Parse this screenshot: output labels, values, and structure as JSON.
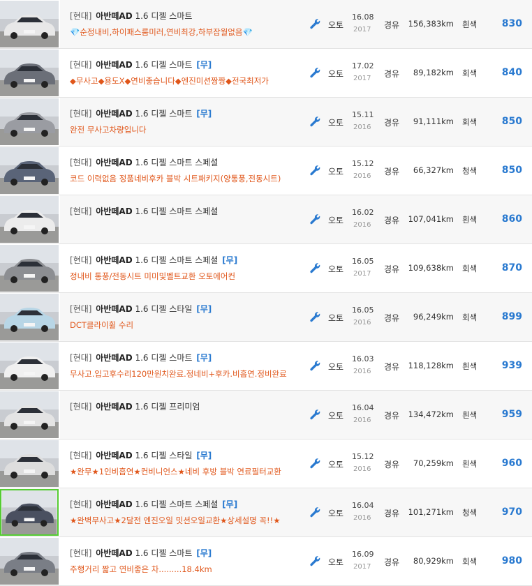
{
  "colors": {
    "accent_blue": "#2a7ad0",
    "desc_orange": "#e0561a",
    "selected_border": "#55cc33"
  },
  "listings": [
    {
      "maker": "[현대]",
      "model": "아반떼AD",
      "trim": "1.6 디젤 스마트",
      "badge": "",
      "desc": "💎순정내비,하이패스룸미러,연비최강,하부잡월없음💎",
      "trans": "오토",
      "date": "16.08",
      "year": "2017",
      "fuel": "경유",
      "km": "156,383km",
      "color": "흰색",
      "price": "830",
      "car_color": "#e8e8e8"
    },
    {
      "maker": "[현대]",
      "model": "아반떼AD",
      "trim": "1.6 디젤 스마트",
      "badge": "[무]",
      "desc": "◆무사고◆용도X◆연비좋습니다◆엔진미션짱짱◆전국최저가",
      "trans": "오토",
      "date": "17.02",
      "year": "2017",
      "fuel": "경유",
      "km": "89,182km",
      "color": "회색",
      "price": "840",
      "car_color": "#6b6f78"
    },
    {
      "maker": "[현대]",
      "model": "아반떼AD",
      "trim": "1.6 디젤 스마트",
      "badge": "[무]",
      "desc": "완전 무사고차량입니다",
      "trans": "오토",
      "date": "15.11",
      "year": "2016",
      "fuel": "경유",
      "km": "91,111km",
      "color": "회색",
      "price": "850",
      "car_color": "#9a9ca2"
    },
    {
      "maker": "[현대]",
      "model": "아반떼AD",
      "trim": "1.6 디젤 스마트 스페셜",
      "badge": "",
      "desc": "코드 이력없음 정품네비후카 블박 시트패키지(양통풍,전동시트)",
      "trans": "오토",
      "date": "15.12",
      "year": "2016",
      "fuel": "경유",
      "km": "66,327km",
      "color": "청색",
      "price": "850",
      "car_color": "#5a6478"
    },
    {
      "maker": "[현대]",
      "model": "아반떼AD",
      "trim": "1.6 디젤 스마트 스페셜",
      "badge": "",
      "desc": "",
      "trans": "오토",
      "date": "16.02",
      "year": "2016",
      "fuel": "경유",
      "km": "107,041km",
      "color": "흰색",
      "price": "860",
      "car_color": "#ececec"
    },
    {
      "maker": "[현대]",
      "model": "아반떼AD",
      "trim": "1.6 디젤 스마트 스페셜",
      "badge": "[무]",
      "desc": "정내비 통풍/전동시트 미미및벨트교환 오토에어컨",
      "trans": "오토",
      "date": "16.05",
      "year": "2017",
      "fuel": "경유",
      "km": "109,638km",
      "color": "회색",
      "price": "870",
      "car_color": "#8c8e92"
    },
    {
      "maker": "[현대]",
      "model": "아반떼AD",
      "trim": "1.6 디젤 스타일",
      "badge": "[무]",
      "desc": "DCT클라이휠 수리",
      "trans": "오토",
      "date": "16.05",
      "year": "2016",
      "fuel": "경유",
      "km": "96,249km",
      "color": "회색",
      "price": "899",
      "car_color": "#b8d6e6"
    },
    {
      "maker": "[현대]",
      "model": "아반떼AD",
      "trim": "1.6 디젤 스마트",
      "badge": "[무]",
      "desc": "무사고.입고후수리120만원치완료.정네비+후카.비흡연.정비완료",
      "trans": "오토",
      "date": "16.03",
      "year": "2016",
      "fuel": "경유",
      "km": "118,128km",
      "color": "흰색",
      "price": "939",
      "car_color": "#f0f0f0"
    },
    {
      "maker": "[현대]",
      "model": "아반떼AD",
      "trim": "1.6 디젤 프리미엄",
      "badge": "",
      "desc": "",
      "trans": "오토",
      "date": "16.04",
      "year": "2016",
      "fuel": "경유",
      "km": "134,472km",
      "color": "흰색",
      "price": "959",
      "car_color": "#e4e4e4"
    },
    {
      "maker": "[현대]",
      "model": "아반떼AD",
      "trim": "1.6 디젤 스타일",
      "badge": "[무]",
      "desc": "★완무★1인비흡연★컨비니언스★네비 후방 블박 연료필터교환",
      "trans": "오토",
      "date": "15.12",
      "year": "2016",
      "fuel": "경유",
      "km": "70,259km",
      "color": "흰색",
      "price": "960",
      "car_color": "#dedede"
    },
    {
      "maker": "[현대]",
      "model": "아반떼AD",
      "trim": "1.6 디젤 스마트 스페셜",
      "badge": "[무]",
      "desc": "★완벽무사고★2달전 엔진오일 밋션오일교환★상세설명 꼭!!★",
      "trans": "오토",
      "date": "16.04",
      "year": "2016",
      "fuel": "경유",
      "km": "101,271km",
      "color": "청색",
      "price": "970",
      "car_color": "#4a5060"
    },
    {
      "maker": "[현대]",
      "model": "아반떼AD",
      "trim": "1.6 디젤 스마트",
      "badge": "[무]",
      "desc": "주행거리 짧고 연비좋은 차.........18.4km",
      "trans": "오토",
      "date": "16.09",
      "year": "2017",
      "fuel": "경유",
      "km": "80,929km",
      "color": "회색",
      "price": "980",
      "car_color": "#7a7e86"
    }
  ]
}
